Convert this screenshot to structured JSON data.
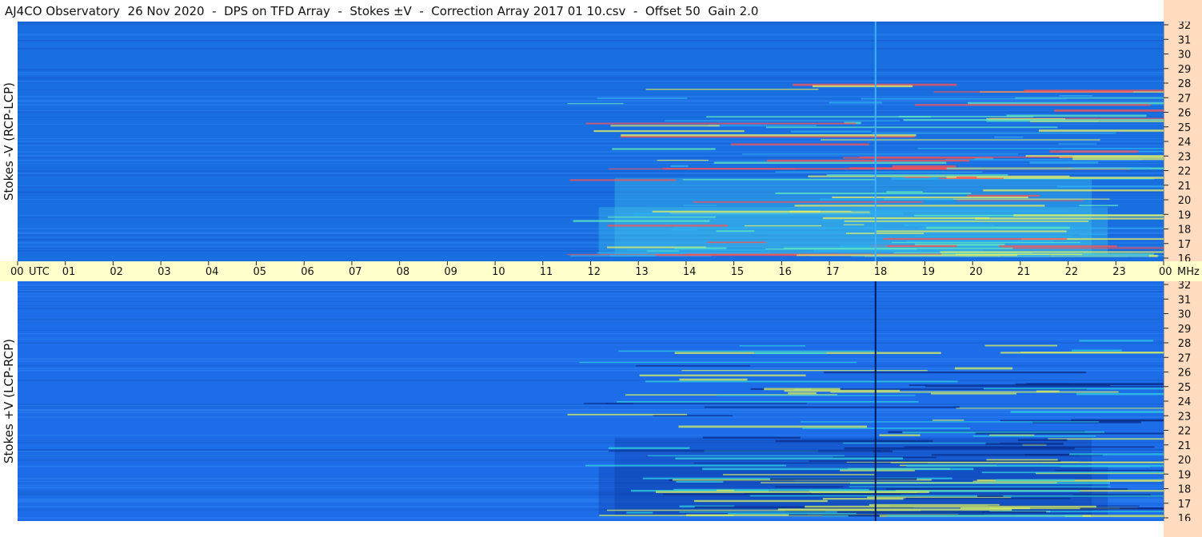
{
  "title": "AJ4CO Observatory  26 Nov 2020  -  DPS on TFD Array  -  Stokes ±V  -  Correction Array 2017 01 10.csv  -  Offset 50  Gain 2.0",
  "chart_data": [
    {
      "type": "heatmap",
      "panel": "top",
      "ylabel": "Stokes -V (RCP-LCP)",
      "xlabel": "UTC",
      "ylabel_right": "MHz",
      "x_ticks": [
        "00",
        "01",
        "02",
        "03",
        "04",
        "05",
        "06",
        "07",
        "08",
        "09",
        "10",
        "11",
        "12",
        "13",
        "14",
        "15",
        "16",
        "17",
        "18",
        "19",
        "20",
        "21",
        "22",
        "23",
        "00"
      ],
      "y_ticks": [
        32,
        31,
        30,
        29,
        28,
        27,
        26,
        25,
        24,
        23,
        22,
        21,
        20,
        19,
        18,
        17,
        16
      ],
      "xlim": [
        0,
        24
      ],
      "ylim": [
        16,
        32
      ],
      "colors": {
        "background": "#1a6fe0",
        "activity": [
          "#2fb0f0",
          "#5fe8c0",
          "#e8f060",
          "#ff5050"
        ]
      },
      "activity_window_utc": [
        11.5,
        23.5
      ],
      "vertical_line_utc": 17.95
    },
    {
      "type": "heatmap",
      "panel": "bottom",
      "ylabel": "Stokes +V (LCP-RCP)",
      "xlabel": "UTC",
      "ylabel_right": "MHz",
      "x_ticks": [
        "00",
        "01",
        "02",
        "03",
        "04",
        "05",
        "06",
        "07",
        "08",
        "09",
        "10",
        "11",
        "12",
        "13",
        "14",
        "15",
        "16",
        "17",
        "18",
        "19",
        "20",
        "21",
        "22",
        "23",
        "00"
      ],
      "y_ticks": [
        32,
        31,
        30,
        29,
        28,
        27,
        26,
        25,
        24,
        23,
        22,
        21,
        20,
        19,
        18,
        17,
        16
      ],
      "xlim": [
        0,
        24
      ],
      "ylim": [
        16,
        32
      ],
      "colors": {
        "background": "#1d6de8",
        "activity": [
          "#0a2c8a",
          "#2fd0e0",
          "#d8f060"
        ]
      },
      "activity_window_utc": [
        11.5,
        23.5
      ],
      "vertical_line_utc": 17.95
    }
  ]
}
